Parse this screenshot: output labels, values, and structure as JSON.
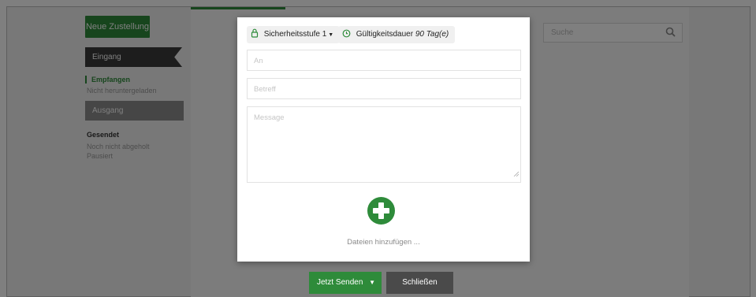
{
  "background": {
    "new_button": "Neue Zustellung",
    "search_placeholder": "Suche",
    "inbox_header": "Eingang",
    "inbox_items": [
      "Empfangen",
      "Nicht heruntergeladen"
    ],
    "outbox_header": "Ausgang",
    "outbox_items": [
      "Gesendet",
      "Noch nicht abgeholt",
      "Pausiert"
    ]
  },
  "modal": {
    "security_level": "Sicherheitsstufe 1",
    "validity_label": "Gültigkeitsdauer",
    "validity_value": "90 Tag(e)",
    "to_placeholder": "An",
    "subject_placeholder": "Betreff",
    "message_placeholder": "Message",
    "add_files_label": "Dateien hinzufügen ..."
  },
  "actions": {
    "send_label": "Jetzt Senden",
    "close_label": "Schließen"
  },
  "colors": {
    "accent_green": "#2e8b3a",
    "dark_grey": "#3a3a3a"
  }
}
